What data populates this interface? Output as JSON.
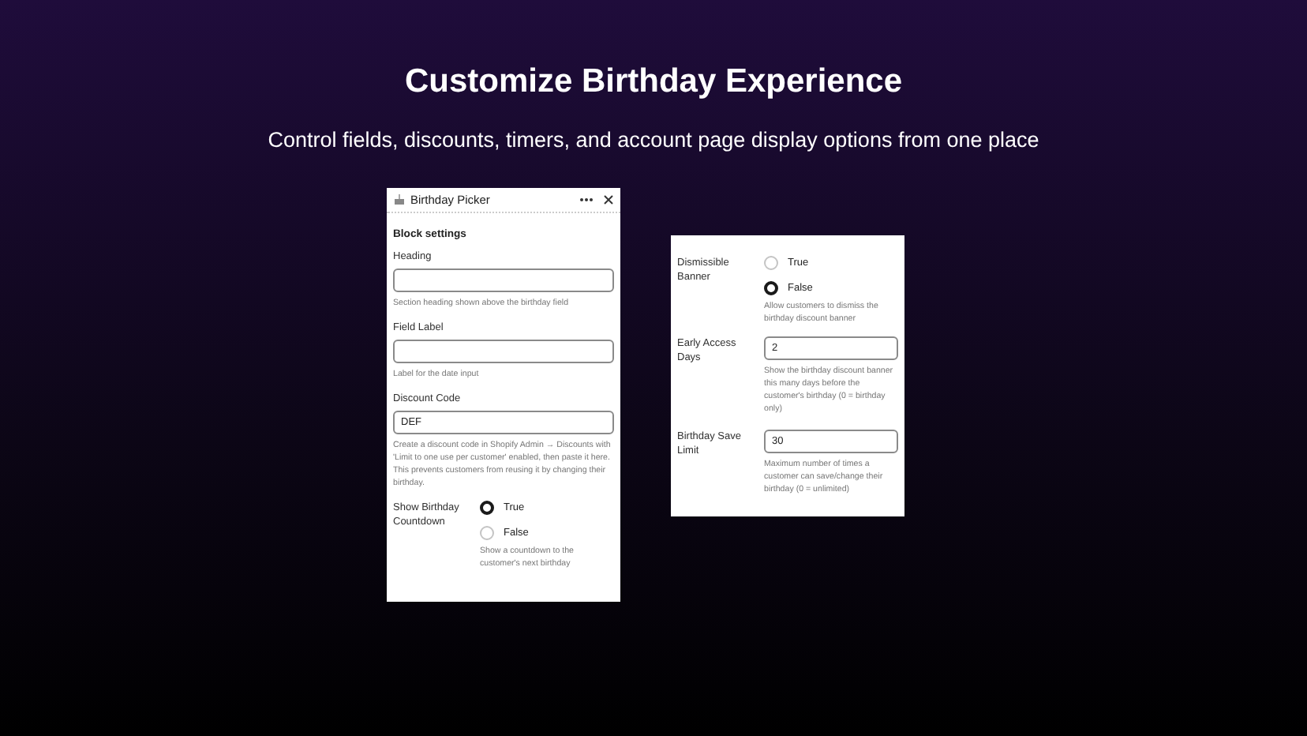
{
  "title": "Customize Birthday Experience",
  "subtitle": "Control fields, discounts, timers, and account page display options from one place",
  "left_panel": {
    "title": "Birthday Picker",
    "section": "Block settings",
    "fields": [
      {
        "kind": "text",
        "label": "Heading",
        "help": "Section heading shown above the birthday field"
      },
      {
        "kind": "text",
        "label": "Field Label",
        "help": "Label for the date input"
      },
      {
        "kind": "text",
        "label": "Discount Code",
        "value": "DEF",
        "help": "Create a discount code in Shopify Admin → Discounts with 'Limit to one use per customer' enabled, then paste it here. This prevents customers from reusing it by changing their birthday."
      },
      {
        "kind": "radio",
        "label": "Show Birthday Countdown",
        "options": [
          {
            "label": "True",
            "selected": true
          },
          {
            "label": "False",
            "selected": false
          }
        ],
        "help": "Show a countdown to the customer's next birthday"
      }
    ]
  },
  "right_panel": {
    "fields": [
      {
        "kind": "radio",
        "label": "Dismissible Banner",
        "options": [
          {
            "label": "True",
            "selected": false
          },
          {
            "label": "False",
            "selected": true
          }
        ],
        "help": "Allow customers to dismiss the birthday discount banner"
      },
      {
        "kind": "inline_text",
        "label": "Early Access Days",
        "value": "2",
        "help": "Show the birthday discount banner this many days before the customer's birthday (0 = birthday only)"
      },
      {
        "kind": "inline_text",
        "label": "Birthday Save Limit",
        "value": "30",
        "help": "Maximum number of times a customer can save/change their birthday (0 = unlimited)"
      }
    ]
  }
}
